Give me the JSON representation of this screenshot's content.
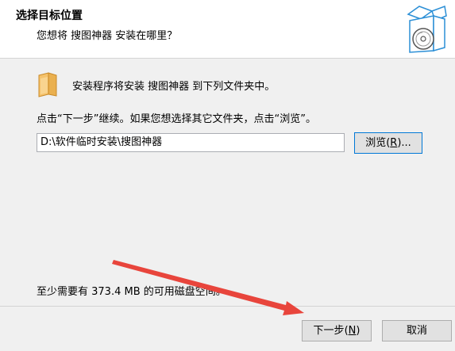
{
  "header": {
    "title": "选择目标位置",
    "subtitle": "您想将 搜图神器 安装在哪里？"
  },
  "main": {
    "intro": "安装程序将安装 搜图神器 到下列文件夹中。",
    "instruction": "点击“下一步”继续。如果您想选择其它文件夹，点击“浏览”。",
    "path_value": "D:\\软件临时安装\\搜图神器",
    "browse_label": "浏览",
    "browse_mnemonic": "R",
    "space_required": "至少需要有 373.4 MB 的可用磁盘空间。"
  },
  "footer": {
    "next_label": "下一步",
    "next_mnemonic": "N",
    "cancel_label": "取消"
  },
  "colors": {
    "annotation_arrow": "#e8453c",
    "focus_border": "#0078d7"
  }
}
